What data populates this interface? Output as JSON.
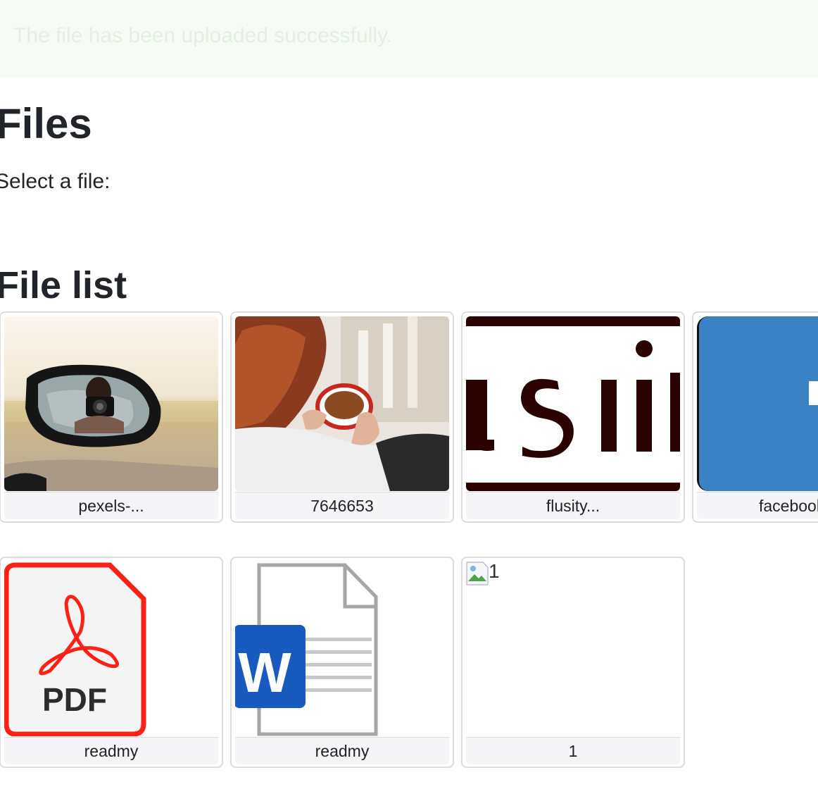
{
  "alert": {
    "message": "The file has been uploaded successfully."
  },
  "heading": "Files",
  "select_label": "Select a file:",
  "list_heading": "File list",
  "files": [
    {
      "name": "pexels-...",
      "type": "image",
      "icon": "photo-mirror-camera"
    },
    {
      "name": "7646653",
      "type": "image",
      "icon": "photo-coffee-cup"
    },
    {
      "name": "flusity...",
      "type": "image",
      "icon": "logo-flusity"
    },
    {
      "name": "facebook",
      "type": "image",
      "icon": "logo-facebook"
    },
    {
      "name": "readmy",
      "type": "pdf",
      "icon": "pdf-file-icon",
      "icon_text": "PDF"
    },
    {
      "name": "readmy",
      "type": "word",
      "icon": "word-file-icon",
      "icon_text": "W"
    },
    {
      "name": "1",
      "type": "image",
      "icon": "broken-image-icon",
      "alt": "1"
    }
  ],
  "colors": {
    "alert_bg": "#f6fcf5",
    "alert_text": "#e3efe1",
    "pdf_red": "#ff2116",
    "word_blue": "#185abd",
    "facebook_blue": "#3b82c4"
  }
}
